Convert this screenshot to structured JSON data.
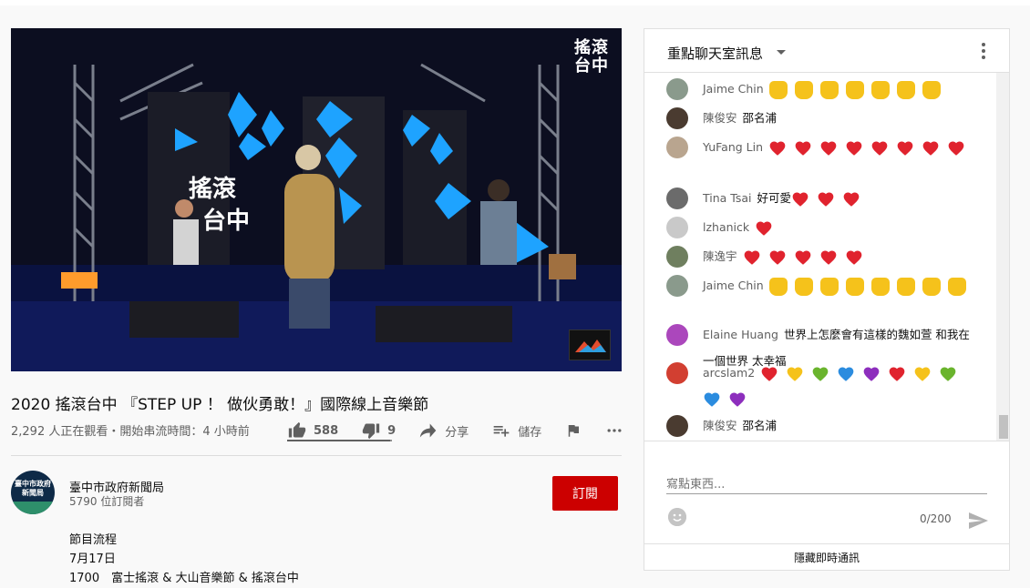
{
  "video": {
    "watermark": "搖滾\n台中"
  },
  "title": "2020 搖滾台中 『STEP UP ！ 做伙勇敢！』國際線上音樂節",
  "meta": "2,292 人正在觀看・開始串流時間：4 小時前",
  "actions": {
    "like_count": "588",
    "dislike_count": "9",
    "share_label": "分享",
    "save_label": "儲存",
    "like_ratio": 0.98
  },
  "channel": {
    "avatar_text": "臺中市政府\n新聞局",
    "name": "臺中市政府新聞局",
    "subscribers": "5790 位訂閱者",
    "subscribe_label": "訂閱"
  },
  "description": {
    "line1": "節目流程",
    "line2": "7月17日",
    "line3": "1700　富士搖滾 & 大山音樂節 & 搖滾台中"
  },
  "chat": {
    "header_title": "重點聊天室訊息",
    "messages": [
      {
        "author": "Jaime Chin",
        "text": "",
        "emoji": "🙌",
        "emoji_count": 7,
        "avatar_color": "#8a9a8c"
      },
      {
        "author": "陳俊安",
        "text": "邵名浦",
        "emoji": "",
        "emoji_count": 0,
        "avatar_color": "#4a3b30"
      },
      {
        "author": "YuFang Lin",
        "text": "",
        "emoji": "❤",
        "emoji_count": 8,
        "avatar_color": "#b9a58f"
      },
      {
        "author": "Tina Tsai",
        "text": "好可愛",
        "emoji": "❤",
        "emoji_count": 3,
        "avatar_color": "#6b6b6b"
      },
      {
        "author": "lzhanick",
        "text": "",
        "emoji": "❤",
        "emoji_count": 1,
        "avatar_color": "#c9c9c9"
      },
      {
        "author": "陳逸宇",
        "text": "",
        "emoji": "❤",
        "emoji_count": 5,
        "avatar_color": "#6f7f5f"
      },
      {
        "author": "Jaime Chin",
        "text": "",
        "emoji": "🤘",
        "emoji_count": 8,
        "avatar_color": "#8a9a8c"
      },
      {
        "author": "Elaine Huang",
        "text": "世界上怎麼會有這樣的魏如萱 和我在一個世界 太幸福",
        "emoji": "",
        "emoji_count": 0,
        "avatar_color": "#ab47bc"
      },
      {
        "author": "arcslam2",
        "text": "",
        "emoji": "mixed",
        "emoji_count": 10,
        "avatar_color": "#d23f31"
      },
      {
        "author": "陳俊安",
        "text": "邵名浦",
        "emoji": "",
        "emoji_count": 0,
        "avatar_color": "#4a3b30"
      }
    ],
    "input_placeholder": "寫點東西...",
    "counter": "0/200",
    "hide_label": "隱藏即時通訊"
  }
}
